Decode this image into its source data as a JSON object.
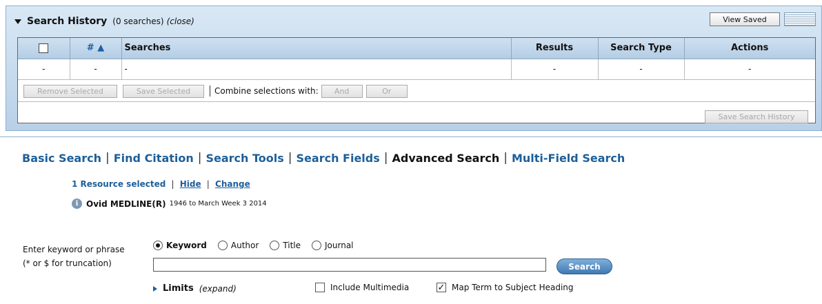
{
  "history": {
    "title": "Search History",
    "count": "(0 searches)",
    "close": "(close)",
    "view_saved": "View Saved",
    "columns": {
      "num": "# ▲",
      "searches": "Searches",
      "results": "Results",
      "search_type": "Search Type",
      "actions": "Actions"
    },
    "empty_row": {
      "check": "-",
      "num": "-",
      "searches": "-",
      "results": "-",
      "search_type": "-",
      "actions": "-"
    },
    "remove_selected": "Remove Selected",
    "save_selected": "Save Selected",
    "combine_label": "Combine selections with:",
    "and": "And",
    "or": "Or",
    "save_history": "Save Search History"
  },
  "tabs": [
    "Basic Search",
    "Find Citation",
    "Search Tools",
    "Search Fields",
    "Advanced Search",
    "Multi-Field Search"
  ],
  "active_tab": "Advanced Search",
  "resource": {
    "selected": "1 Resource selected",
    "hide": "Hide",
    "change": "Change",
    "db_name": "Ovid MEDLINE(R)",
    "db_range": "1946 to March Week 3 2014"
  },
  "search": {
    "label_line1": "Enter keyword or phrase",
    "label_line2": "(* or $ for truncation)",
    "options": [
      "Keyword",
      "Author",
      "Title",
      "Journal"
    ],
    "selected_option": "Keyword",
    "input_value": "",
    "button": "Search"
  },
  "limits": {
    "label": "Limits",
    "expand": "(expand)"
  },
  "checkboxes": {
    "multimedia": "Include Multimedia",
    "multimedia_checked": false,
    "map_term": "Map Term to Subject Heading",
    "map_term_checked": true
  },
  "colors": {
    "link_blue": "#1d5f99",
    "panel_blue": "#b8d0e8",
    "search_button": "#3f79b3"
  },
  "icons": {
    "collapse": "triangle-down-icon",
    "menu": "menu-grid-icon",
    "info": "info-icon",
    "limits": "triangle-right-icon"
  }
}
